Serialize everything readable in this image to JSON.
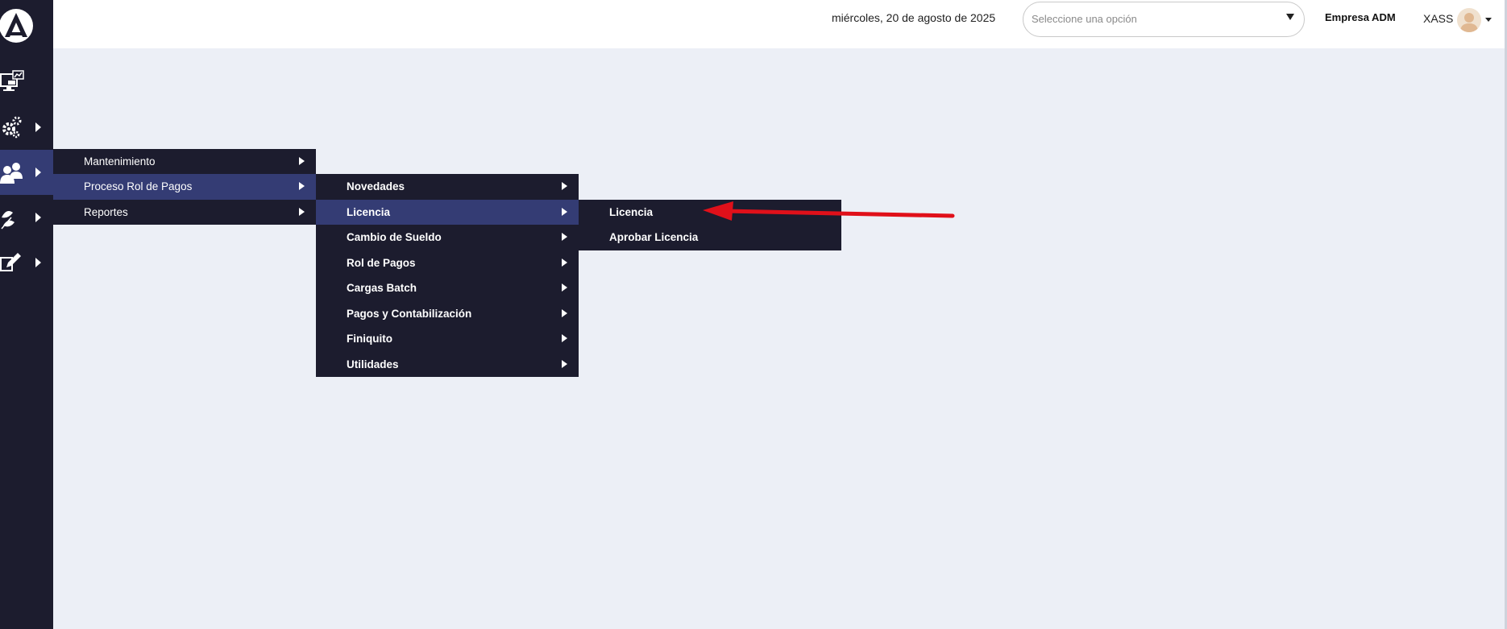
{
  "header": {
    "date": "miércoles, 20 de agosto de 2025",
    "select_placeholder": "Seleccione una opción",
    "company": "Empresa ADM",
    "user": "XASS"
  },
  "sidebar": {
    "items": [
      {
        "icon": "dashboard-monitor-icon",
        "has_submenu": false
      },
      {
        "icon": "gears-icon",
        "has_submenu": true
      },
      {
        "icon": "users-icon",
        "has_submenu": true,
        "active": true
      },
      {
        "icon": "leaves-icon",
        "has_submenu": true
      },
      {
        "icon": "edit-pencil-icon",
        "has_submenu": true
      }
    ]
  },
  "menu_level1": {
    "items": [
      {
        "label": "Mantenimiento"
      },
      {
        "label": "Proceso Rol de Pagos",
        "active": true
      },
      {
        "label": "Reportes"
      }
    ]
  },
  "menu_level2": {
    "items": [
      {
        "label": "Novedades"
      },
      {
        "label": "Licencia",
        "active": true
      },
      {
        "label": "Cambio de Sueldo"
      },
      {
        "label": "Rol de Pagos"
      },
      {
        "label": "Cargas Batch"
      },
      {
        "label": "Pagos y Contabilización"
      },
      {
        "label": "Finiquito"
      },
      {
        "label": "Utilidades"
      }
    ]
  },
  "menu_level3": {
    "items": [
      {
        "label": "Licencia"
      },
      {
        "label": "Aprobar Licencia"
      }
    ]
  },
  "colors": {
    "sidebar_bg": "#1c1c2e",
    "active_bg": "#343c74",
    "content_bg": "#eceff6",
    "annotation": "#e0101a"
  }
}
